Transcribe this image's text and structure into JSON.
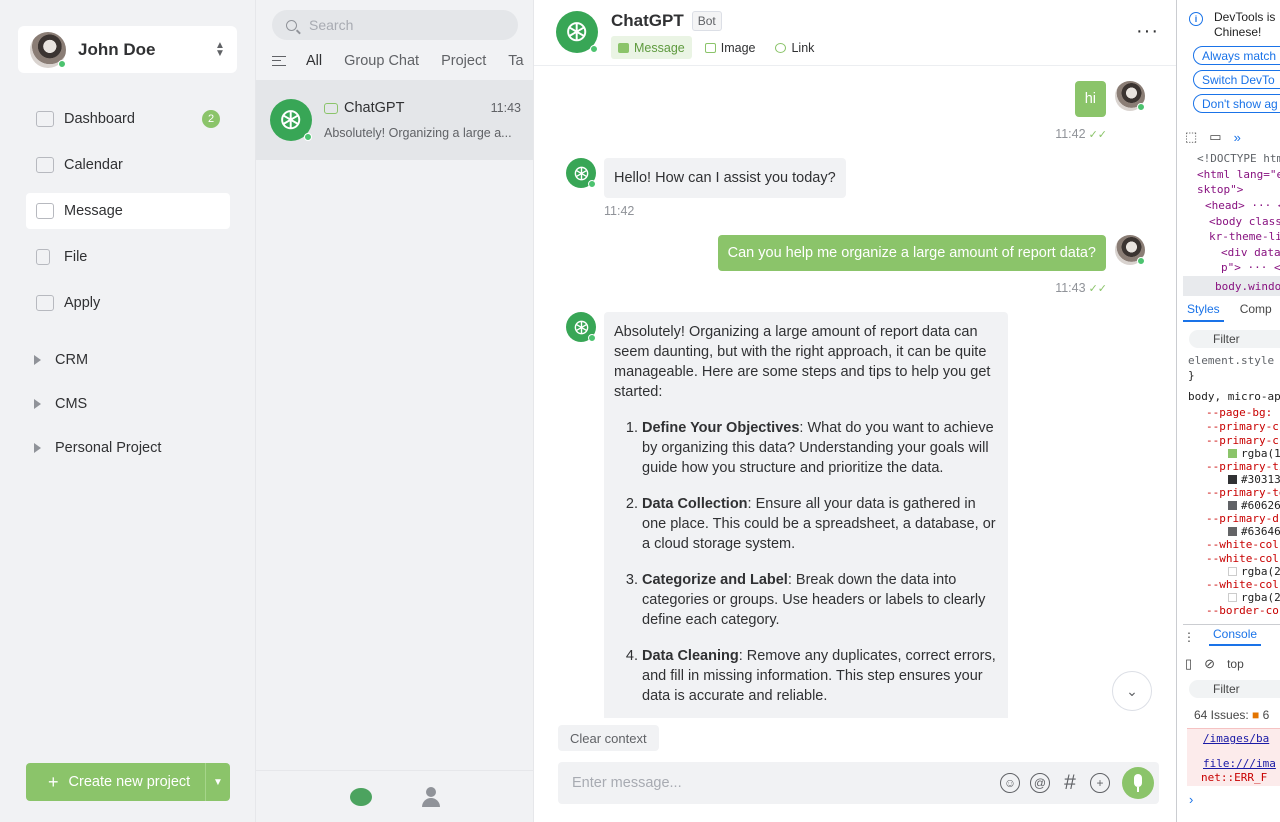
{
  "user": {
    "name": "John Doe"
  },
  "nav": {
    "items": [
      {
        "label": "Dashboard",
        "badge": "2"
      },
      {
        "label": "Calendar"
      },
      {
        "label": "Message"
      },
      {
        "label": "File"
      },
      {
        "label": "Apply"
      }
    ],
    "groups": [
      "CRM",
      "CMS",
      "Personal Project"
    ],
    "create_label": "Create new project"
  },
  "conversations": {
    "search_placeholder": "Search",
    "filters": [
      "All",
      "Group Chat",
      "Project",
      "Ta"
    ],
    "items": [
      {
        "name": "ChatGPT",
        "time": "11:43",
        "snippet": "Absolutely! Organizing a large a..."
      }
    ]
  },
  "chat": {
    "title": "ChatGPT",
    "tag": "Bot",
    "tabs": [
      "Message",
      "Image",
      "Link"
    ],
    "messages": [
      {
        "from": "me",
        "text": "hi",
        "time": "11:42"
      },
      {
        "from": "bot",
        "text": "Hello! How can I assist you today?",
        "time": "11:42"
      },
      {
        "from": "me",
        "text": "Can you help me organize a large amount of report data?",
        "time": "11:43"
      },
      {
        "from": "bot",
        "intro": "Absolutely! Organizing a large amount of report data can seem daunting, but with the right approach, it can be quite manageable. Here are some steps and tips to help you get started:",
        "steps": [
          {
            "title": "Define Your Objectives",
            "text": ": What do you want to achieve by organizing this data? Understanding your goals will guide how you structure and prioritize the data."
          },
          {
            "title": "Data Collection",
            "text": ": Ensure all your data is gathered in one place. This could be a spreadsheet, a database, or a cloud storage system."
          },
          {
            "title": "Categorize and Label",
            "text": ": Break down the data into categories or groups. Use headers or labels to clearly define each category."
          },
          {
            "title": "Data Cleaning",
            "text": ": Remove any duplicates, correct errors, and fill in missing information. This step ensures your data is accurate and reliable."
          }
        ]
      }
    ],
    "clear_context": "Clear context",
    "input_placeholder": "Enter message..."
  },
  "devtools": {
    "info_line1": "DevTools is",
    "info_line2": "Chinese!",
    "buttons": [
      "Always match",
      "Switch DevTo",
      "Don't show ag"
    ],
    "code": [
      "<!DOCTYPE htm",
      "<html lang=\"e",
      "sktop\">",
      "<head> ··· </",
      "<body class",
      "kr-theme-li",
      "<div data",
      "p\"> ··· </d"
    ],
    "selected": "body.window",
    "tabs": [
      "Styles",
      "Comp"
    ],
    "filter": "Filter",
    "css": [
      "element.style",
      "}",
      "body, micro-ap",
      "--page-bg:",
      "--primary-c",
      "--primary-c",
      "rgba(1",
      "--primary-ti",
      "#30313",
      "--primary-te",
      "#60626",
      "--primary-d",
      "#63646",
      "--white-col",
      "--white-col",
      "rgba(2",
      "--white-col",
      "rgba(2",
      "--border-co"
    ],
    "console_tab": "Console",
    "console_context": "top",
    "issues": "64 Issues:",
    "issues_count": "6",
    "error_link1": "/images/ba",
    "error_link2": "file:///ima",
    "error_text": "net::ERR_F"
  }
}
